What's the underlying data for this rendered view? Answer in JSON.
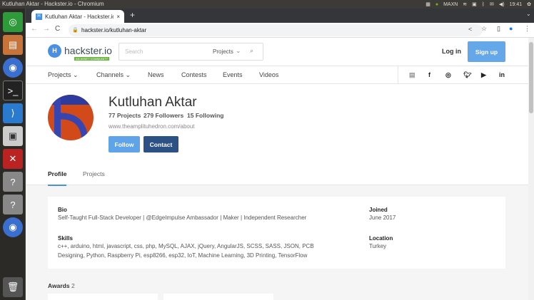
{
  "os": {
    "window_title": "Kutluhan Aktar - Hackster.io - Chromium",
    "tray": {
      "power_mode": "MAXN",
      "time": "19:41"
    }
  },
  "browser": {
    "tab_title": "Kutluhan Aktar - Hackster.io",
    "url": "hackster.io/kutluhan-aktar"
  },
  "header": {
    "logo": "hackster.io",
    "logo_tagline": "AN AVNET COMMUNITY",
    "search_placeholder": "Search",
    "search_scope": "Projects",
    "login": "Log in",
    "signup": "Sign up"
  },
  "nav": {
    "items": [
      "Projects",
      "Channels",
      "News",
      "Contests",
      "Events",
      "Videos"
    ]
  },
  "profile": {
    "name": "Kutluhan Aktar",
    "projects": "77 Projects",
    "followers": "279 Followers",
    "following": "15 Following",
    "website": "www.theamplituhedron.com/about",
    "follow": "Follow",
    "contact": "Contact",
    "tabs": [
      "Profile",
      "Projects"
    ]
  },
  "about": {
    "bio_label": "Bio",
    "bio": "Self-Taught Full-Stack Developer | @EdgeImpulse Ambassador | Maker | Independent Researcher",
    "skills_label": "Skills",
    "skills": "c++, arduino, html, javascript, css, php, MySQL, AJAX, jQuery, AngularJS, SCSS, SASS, JSON, PCB Designing, Python, Raspberry Pi, esp8266, esp32, IoT, Machine Learning, 3D Printing, TensorFlow",
    "joined_label": "Joined",
    "joined": "June 2017",
    "location_label": "Location",
    "location": "Turkey"
  },
  "awards": {
    "label": "Awards",
    "count": "2"
  },
  "colors": {
    "brand": "#4a90e2",
    "follow": "#5fa3e8",
    "contact": "#2c5185",
    "avatar_orange": "#d2491a",
    "avatar_blue": "#2d3a9e"
  }
}
